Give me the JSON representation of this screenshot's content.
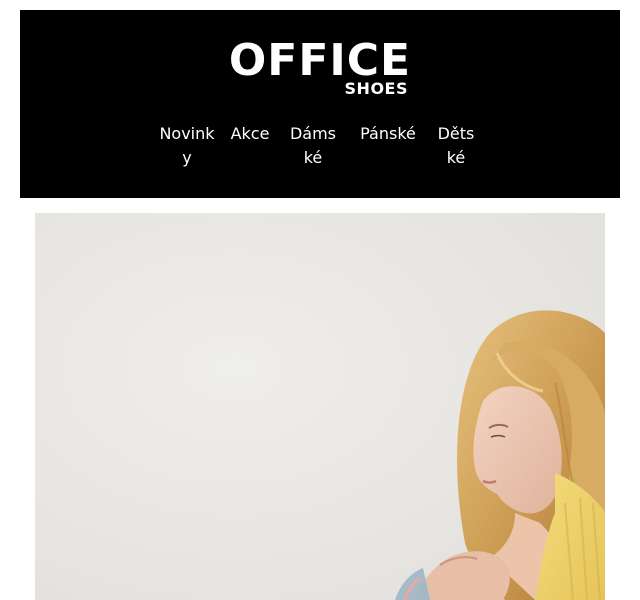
{
  "brand": {
    "logo_main": "OFFICE",
    "logo_sub": "SHOES"
  },
  "nav": {
    "items": [
      {
        "label": "Novinky"
      },
      {
        "label": "Akce"
      },
      {
        "label": "Dámské"
      },
      {
        "label": "Pánské"
      },
      {
        "label": "Dětské"
      }
    ]
  },
  "colors": {
    "header_bg": "#000000",
    "header_text": "#ffffff",
    "hero_bg": "#e9e7e4"
  }
}
